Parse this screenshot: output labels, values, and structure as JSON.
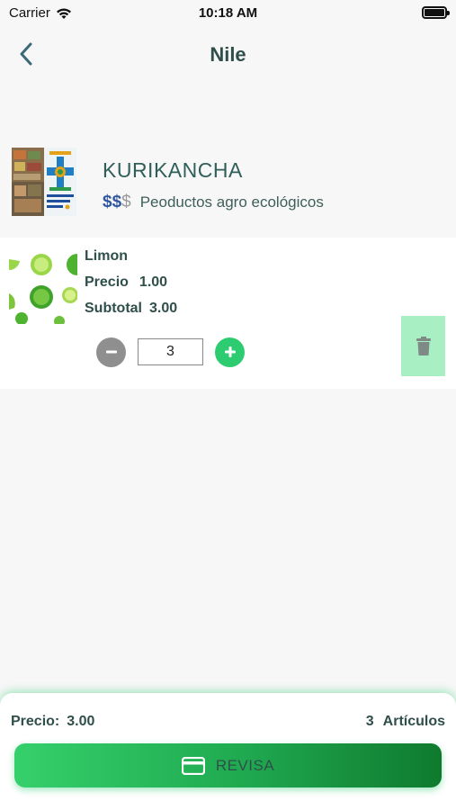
{
  "status_bar": {
    "carrier": "Carrier",
    "time": "10:18 AM"
  },
  "nav": {
    "title": "Nile",
    "back_icon": "chevron-left-icon"
  },
  "store": {
    "name": "KURIKANCHA",
    "price_level_active": "$$",
    "price_level_inactive": "$",
    "description": "Peoductos agro ecológicos",
    "logo_text": "KURIKANCHA PLAZA DE LA VIDA"
  },
  "cart": {
    "items": [
      {
        "name": "Limon",
        "price_label": "Precio",
        "price": "1.00",
        "subtotal_label": "Subtotal",
        "subtotal": "3.00",
        "quantity": "3"
      }
    ]
  },
  "summary": {
    "total_label": "Precio:",
    "total": "3.00",
    "items_count": "3",
    "items_label": "Artículos",
    "checkout_label": "REVISA",
    "checkout_icon": "credit-card-icon"
  },
  "colors": {
    "accent_green": "#2ecc71",
    "title_text": "#2f4f4a",
    "price_level_blue": "#2f57a0",
    "delete_bg": "#a8efc4"
  }
}
